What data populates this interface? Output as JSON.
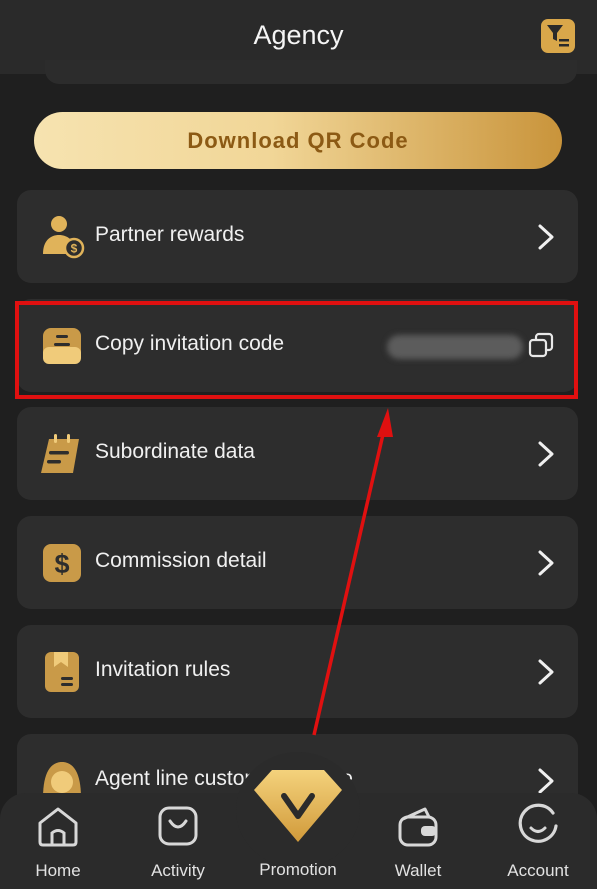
{
  "header": {
    "title": "Agency",
    "filter_icon": "filter-list-icon"
  },
  "qr_button": {
    "label": "Download QR Code"
  },
  "menu": [
    {
      "label": "Partner rewards",
      "icon": "partner-rewards-icon"
    },
    {
      "label": "Copy invitation code",
      "icon": "invitation-box-icon"
    },
    {
      "label": "Subordinate data",
      "icon": "calendar-note-icon"
    },
    {
      "label": "Commission detail",
      "icon": "dollar-icon"
    },
    {
      "label": "Invitation rules",
      "icon": "bookmark-doc-icon"
    },
    {
      "label": "Agent line customer service",
      "icon": "customer-service-icon"
    }
  ],
  "bottom_nav": [
    {
      "label": "Home",
      "icon": "home-icon"
    },
    {
      "label": "Activity",
      "icon": "activity-bag-icon"
    },
    {
      "label": "Promotion",
      "icon": "promotion-diamond-icon"
    },
    {
      "label": "Wallet",
      "icon": "wallet-icon"
    },
    {
      "label": "Account",
      "icon": "account-icon"
    }
  ],
  "colors": {
    "background": "#1f1f1f",
    "card": "#2d2d2d",
    "gold": "#d9a74a",
    "highlight": "#e01010"
  }
}
